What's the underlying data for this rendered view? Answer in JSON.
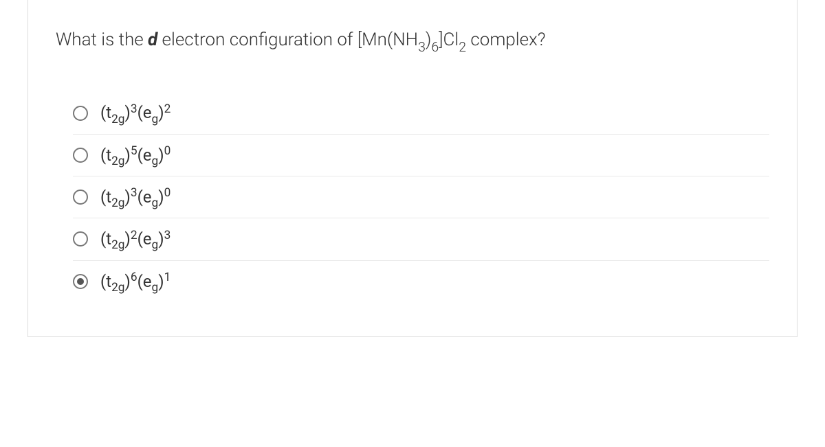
{
  "question": {
    "prefix": "What is the ",
    "italic": "d",
    "mid": " electron configuration of [Mn(NH",
    "sub1": "3",
    "after_sub1": ")",
    "sub2": "6",
    "after_sub2": "]Cl",
    "sub3": "2",
    "suffix": " complex?"
  },
  "options": [
    {
      "t2g_exp": "3",
      "eg_exp": "2",
      "selected": false
    },
    {
      "t2g_exp": "5",
      "eg_exp": "0",
      "selected": false
    },
    {
      "t2g_exp": "3",
      "eg_exp": "0",
      "selected": false
    },
    {
      "t2g_exp": "2",
      "eg_exp": "3",
      "selected": false
    },
    {
      "t2g_exp": "6",
      "eg_exp": "1",
      "selected": true
    }
  ],
  "label_parts": {
    "t2g_open": "(t",
    "t2g_sub": "2g",
    "t2g_close": ")",
    "eg_open": "(e",
    "eg_sub": "g",
    "eg_close": ")"
  }
}
